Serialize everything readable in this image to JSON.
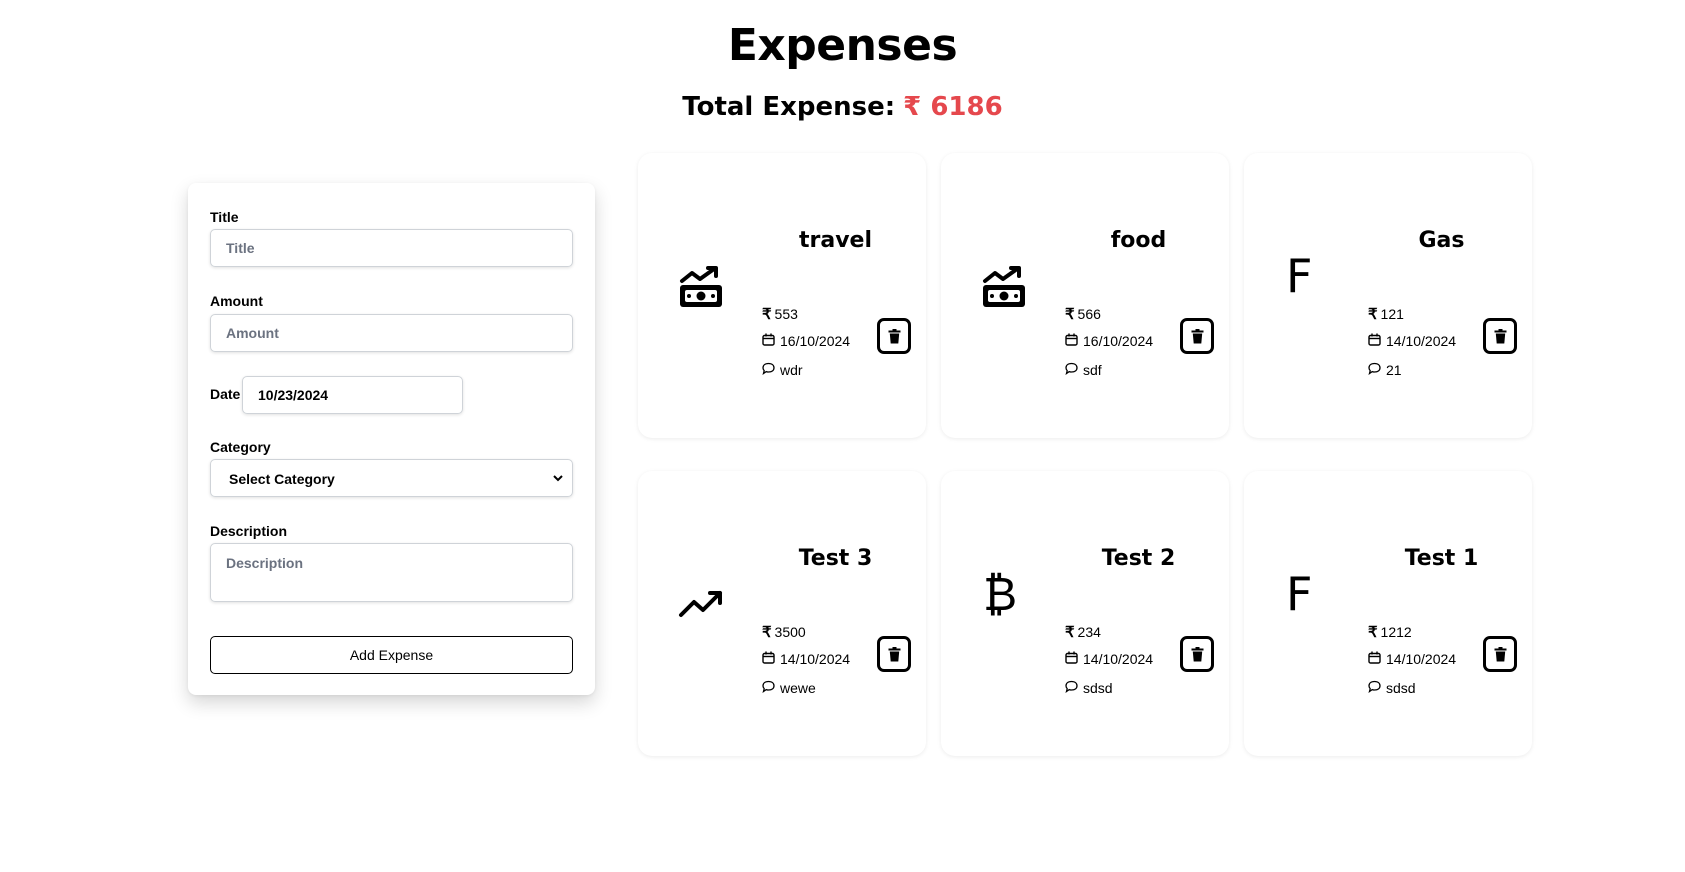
{
  "header": {
    "title": "Expenses",
    "total_label": "Total Expense:",
    "total_value": "₹ 6186",
    "accent_color": "#e5484d"
  },
  "form": {
    "title_label": "Title",
    "title_placeholder": "Title",
    "amount_label": "Amount",
    "amount_placeholder": "Amount",
    "date_label": "Date",
    "date_value": "10/23/2024",
    "category_label": "Category",
    "category_selected": "Select Category",
    "description_label": "Description",
    "description_placeholder": "Description",
    "submit_label": "Add Expense"
  },
  "expenses": [
    {
      "title": "travel",
      "icon": "money-trend-icon",
      "amount": "553",
      "date": "16/10/2024",
      "note": "wdr"
    },
    {
      "title": "food",
      "icon": "money-trend-icon",
      "amount": "566",
      "date": "16/10/2024",
      "note": "sdf"
    },
    {
      "title": "Gas",
      "icon": "letter-f-icon",
      "icon_text": "F",
      "amount": "121",
      "date": "14/10/2024",
      "note": "21"
    },
    {
      "title": "Test 3",
      "icon": "trending-up-icon",
      "amount": "3500",
      "date": "14/10/2024",
      "note": "wewe"
    },
    {
      "title": "Test 2",
      "icon": "bitcoin-icon",
      "icon_text": "₿",
      "amount": "234",
      "date": "14/10/2024",
      "note": "sdsd"
    },
    {
      "title": "Test 1",
      "icon": "letter-f-icon",
      "icon_text": "F",
      "amount": "1212",
      "date": "14/10/2024",
      "note": "sdsd"
    }
  ]
}
